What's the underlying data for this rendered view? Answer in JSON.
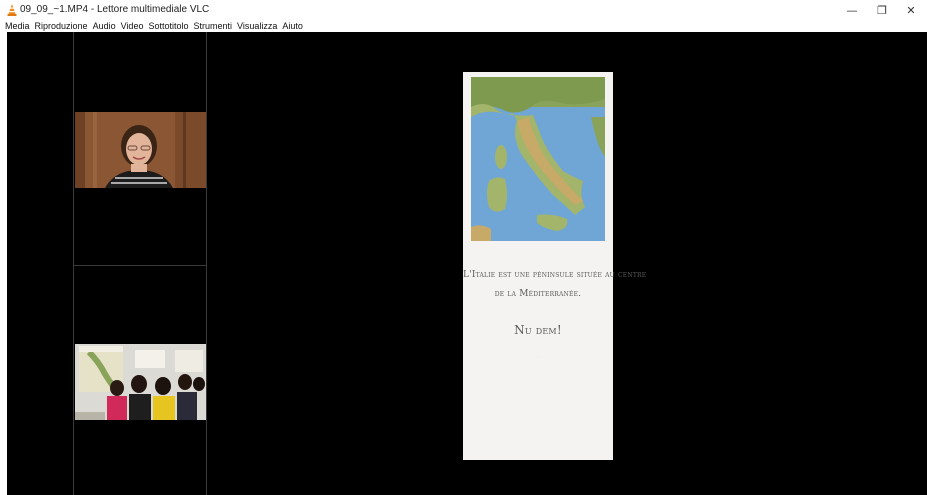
{
  "window": {
    "title": "09_09_~1.MP4 - Lettore multimediale VLC",
    "minimize_symbol": "—",
    "restore_symbol": "❐",
    "close_symbol": "✕"
  },
  "menu": {
    "items": [
      {
        "label": "Media"
      },
      {
        "label": "Riproduzione"
      },
      {
        "label": "Audio"
      },
      {
        "label": "Video"
      },
      {
        "label": "Sottotitolo"
      },
      {
        "label": "Strumenti"
      },
      {
        "label": "Visualizza"
      },
      {
        "label": "Aiuto"
      }
    ]
  },
  "slide": {
    "line1": "L'Italie est une péninsule située au centre",
    "line2": "de la Méditerranée.",
    "line3": "Nu dem!",
    "footer": "...",
    "map_icon": "italy-map",
    "colors": {
      "background": "#f4f3f1",
      "sea": "#6fa6d6",
      "land": "#7d9a4f"
    }
  },
  "icons": {
    "app": "vlc-cone-icon"
  }
}
